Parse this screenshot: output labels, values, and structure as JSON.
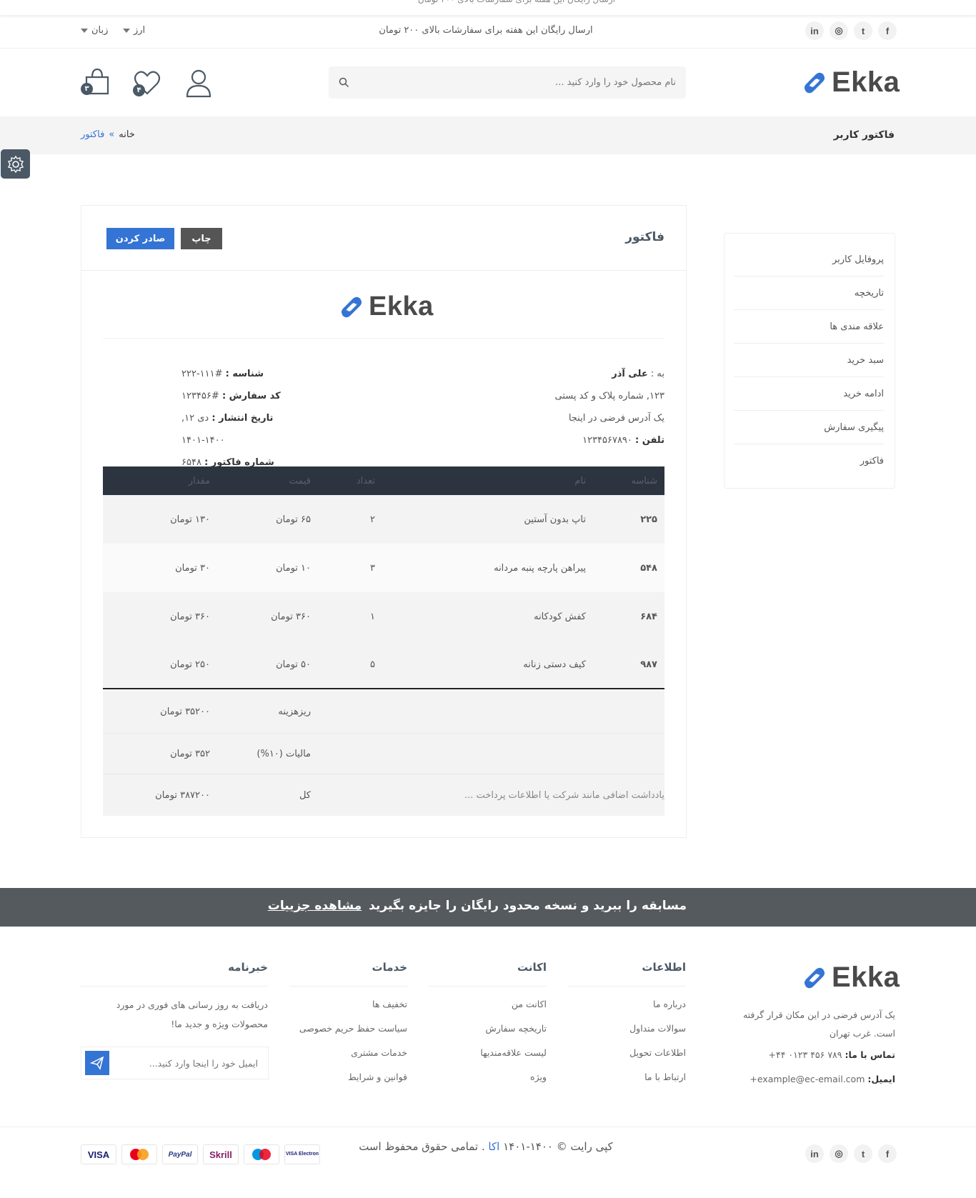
{
  "header": {
    "free_shipping": "ارسال رایگان این هفته برای سفارشات بالای ۲۰۰ تومان",
    "currency": "ارز",
    "language": "زبان",
    "social": [
      "f",
      "t",
      "ig",
      "in"
    ],
    "search_placeholder": "نام محصول خود را وارد کنید ...",
    "wishlist_count": "۴",
    "cart_count": "۳",
    "logo_text": "Ekka"
  },
  "breadcrumb": {
    "title": "فاکتور کاربر",
    "home": "خانه",
    "current": "فاکتور"
  },
  "sidebar": {
    "items": [
      "پروفایل کاربر",
      "تاریخچه",
      "علاقه مندی ها",
      "سبد خرید",
      "ادامه خرید",
      "پیگیری سفارش",
      "فاکتور"
    ]
  },
  "invoice": {
    "heading": "فاکتور",
    "print_label": "چاپ",
    "export_label": "صادر کردن",
    "logo_text": "Ekka",
    "to_label": "به :",
    "to_name": "علی آذر",
    "address1": "۱۲۳, شماره پلاک و کد پستی",
    "address2": "یک آدرس فرضی در اینجا",
    "phone_label": "تلفن :",
    "phone": "۱۲۳۴۵۶۷۸۹۰",
    "id_label": "شناسه :",
    "id_value": "#۱۱۱-۲۲۲",
    "order_label": "کد سفارش :",
    "order_value": "#۱۲۳۴۵۶",
    "date_label": "تاریخ انتشار :",
    "date_value": "دی ۱۲, ۱۴۰۰-۱۴۰۱",
    "number_label": "شماره فاکتور :",
    "number_value": "۶۵۴۸",
    "columns": [
      "شناسه",
      "نام",
      "تعداد",
      "قیمت",
      "مقدار"
    ],
    "rows": [
      {
        "id": "۲۲۵",
        "name": "تاپ بدون آستین",
        "qty": "۲",
        "price": "۶۵ تومان",
        "amount": "۱۳۰ تومان"
      },
      {
        "id": "۵۴۸",
        "name": "پیراهن پارچه پنبه مردانه",
        "qty": "۳",
        "price": "۱۰ تومان",
        "amount": "۳۰ تومان"
      },
      {
        "id": "۶۸۴",
        "name": "کفش کودکانه",
        "qty": "۱",
        "price": "۳۶۰ تومان",
        "amount": "۳۶۰ تومان"
      },
      {
        "id": "۹۸۷",
        "name": "کیف دستی زنانه",
        "qty": "۵",
        "price": "۵۰ تومان",
        "amount": "۲۵۰ تومان"
      }
    ],
    "subtotal_label": "ریزهزینه",
    "subtotal": "۳۵۲۰۰ تومان",
    "tax_label": "مالیات (۱۰%)",
    "tax": "۳۵۲ تومان",
    "total_label": "کل",
    "total": "۳۸۷۲۰۰ تومان",
    "note": "یادداشت اضافی مانند شرکت یا اطلاعات پرداخت ..."
  },
  "promo": {
    "text": "مسابقه را ببرید و نسخه محدود رایگان را جایزه بگیرید",
    "link": "مشاهده جزییات"
  },
  "footer": {
    "logo_text": "Ekka",
    "address": "یک آدرس فرضی در این مکان قرار گرفته است. غرب تهران",
    "contact_label": "تماس با ما:",
    "contact": "+۴۴ ۰۱۲۳ ۴۵۶ ۷۸۹",
    "email_label": "ایمیل:",
    "email": "example@ec-email.com+",
    "info_title": "اطلاعات",
    "info_links": [
      "درباره ما",
      "سوالات متداول",
      "اطلاعات تحویل",
      "ارتباط با ما"
    ],
    "account_title": "اکانت",
    "account_links": [
      "اکانت من",
      "تاریخچه سفارش",
      "لیست علاقه‌مندیها",
      "ویژه"
    ],
    "services_title": "خدمات",
    "services_links": [
      "تخفیف ها",
      "سیاست حفظ حریم خصوصی",
      "خدمات مشتری",
      "قوانین و شرایط"
    ],
    "newsletter_title": "خبرنامه",
    "newsletter_text": "دریافت به روز رسانی های فوری در مورد محصولات ویژه و جدید ما!",
    "newsletter_placeholder": "ایمیل خود را اینجا وارد کنید...",
    "copyright_pre": "کپی رایت © ۱۴۰۰-۱۴۰۱",
    "copyright_brand": "اکا",
    "copyright_post": ". تمامی حقوق محفوظ است",
    "payments": [
      "VISA Electron",
      "Maestro",
      "Skrill",
      "PayPal",
      "MasterCard",
      "VISA"
    ]
  },
  "colors": {
    "accent": "#3474d4",
    "dark": "#4b5966",
    "table_head": "#2c343f",
    "promo": "#555a5f"
  }
}
